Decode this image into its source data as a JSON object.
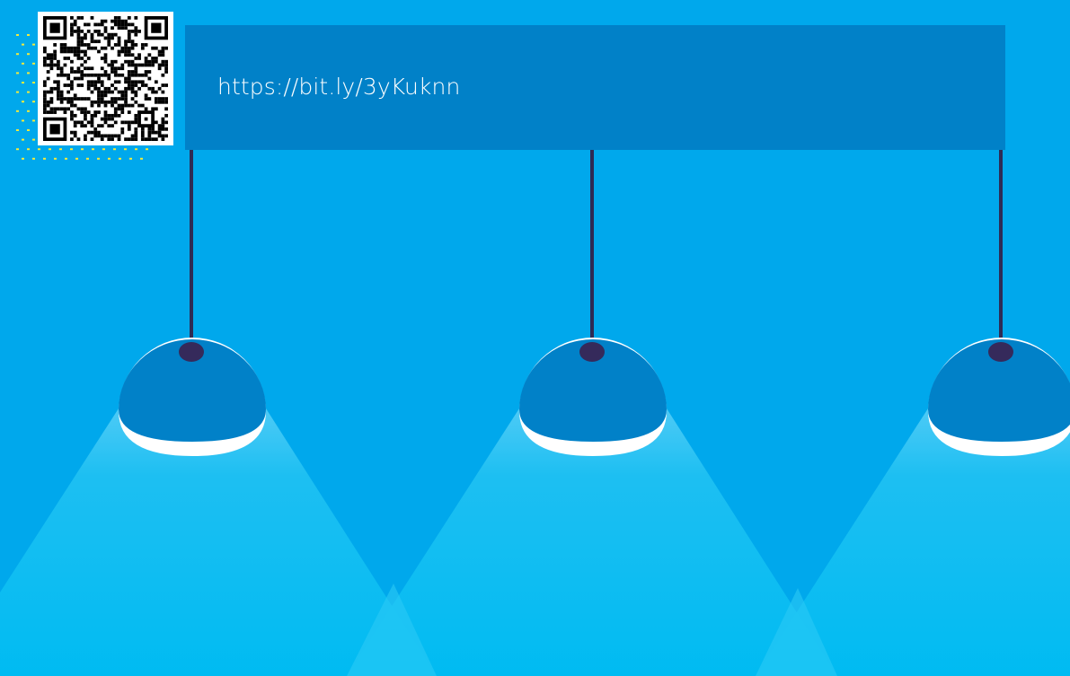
{
  "banner": {
    "url_text": "https://bit.ly/3yKuknn"
  },
  "qr_code": {
    "icon": "qr-code-icon"
  },
  "colors": {
    "background": "#00a8ec",
    "banner": "#0181c8",
    "lamp_shade": "#0181c8",
    "lamp_cord": "#2e2b54",
    "light_beam": "#00bff3",
    "dot_pattern": "#f2ec3c"
  }
}
